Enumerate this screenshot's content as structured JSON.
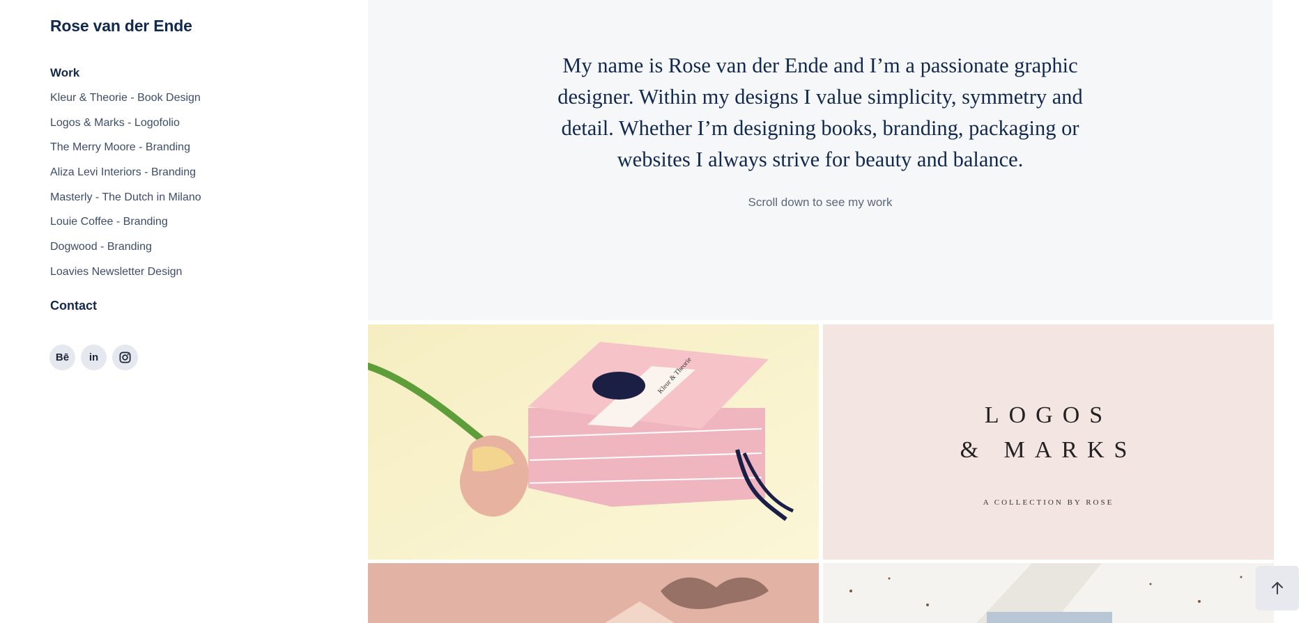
{
  "site": {
    "title": "Rose van der Ende"
  },
  "nav": {
    "work_heading": "Work",
    "items": [
      {
        "label": "Kleur & Theorie - Book Design"
      },
      {
        "label": "Logos & Marks - Logofolio"
      },
      {
        "label": "The Merry Moore - Branding"
      },
      {
        "label": "Aliza Levi Interiors - Branding"
      },
      {
        "label": "Masterly - The Dutch in Milano"
      },
      {
        "label": "Louie Coffee - Branding"
      },
      {
        "label": "Dogwood - Branding"
      },
      {
        "label": "Loavies Newsletter Design"
      }
    ],
    "contact_heading": "Contact"
  },
  "socials": [
    {
      "icon": "behance-icon",
      "glyph": "Bē"
    },
    {
      "icon": "linkedin-icon",
      "glyph": "in"
    },
    {
      "icon": "instagram-icon",
      "glyph": ""
    }
  ],
  "intro": {
    "text": "My name is Rose van der Ende and I’m a passionate graphic designer. Within my designs I value simplicity, symmetry and detail. Whether I’m designing books, branding, packaging or websites I always strive for beauty and balance.",
    "subtext": "Scroll down to see my work"
  },
  "gallery": {
    "book": {
      "title": "Kleur & Theorie",
      "author": "Rose van der Ende"
    },
    "logos": {
      "line1": "LOGOS",
      "line2": "& MARKS",
      "caption": "A COLLECTION BY ROSE"
    }
  },
  "colors": {
    "navy": "#12294f",
    "intro_bg": "#f6f7f9",
    "social_bg": "#e6e8ef"
  }
}
